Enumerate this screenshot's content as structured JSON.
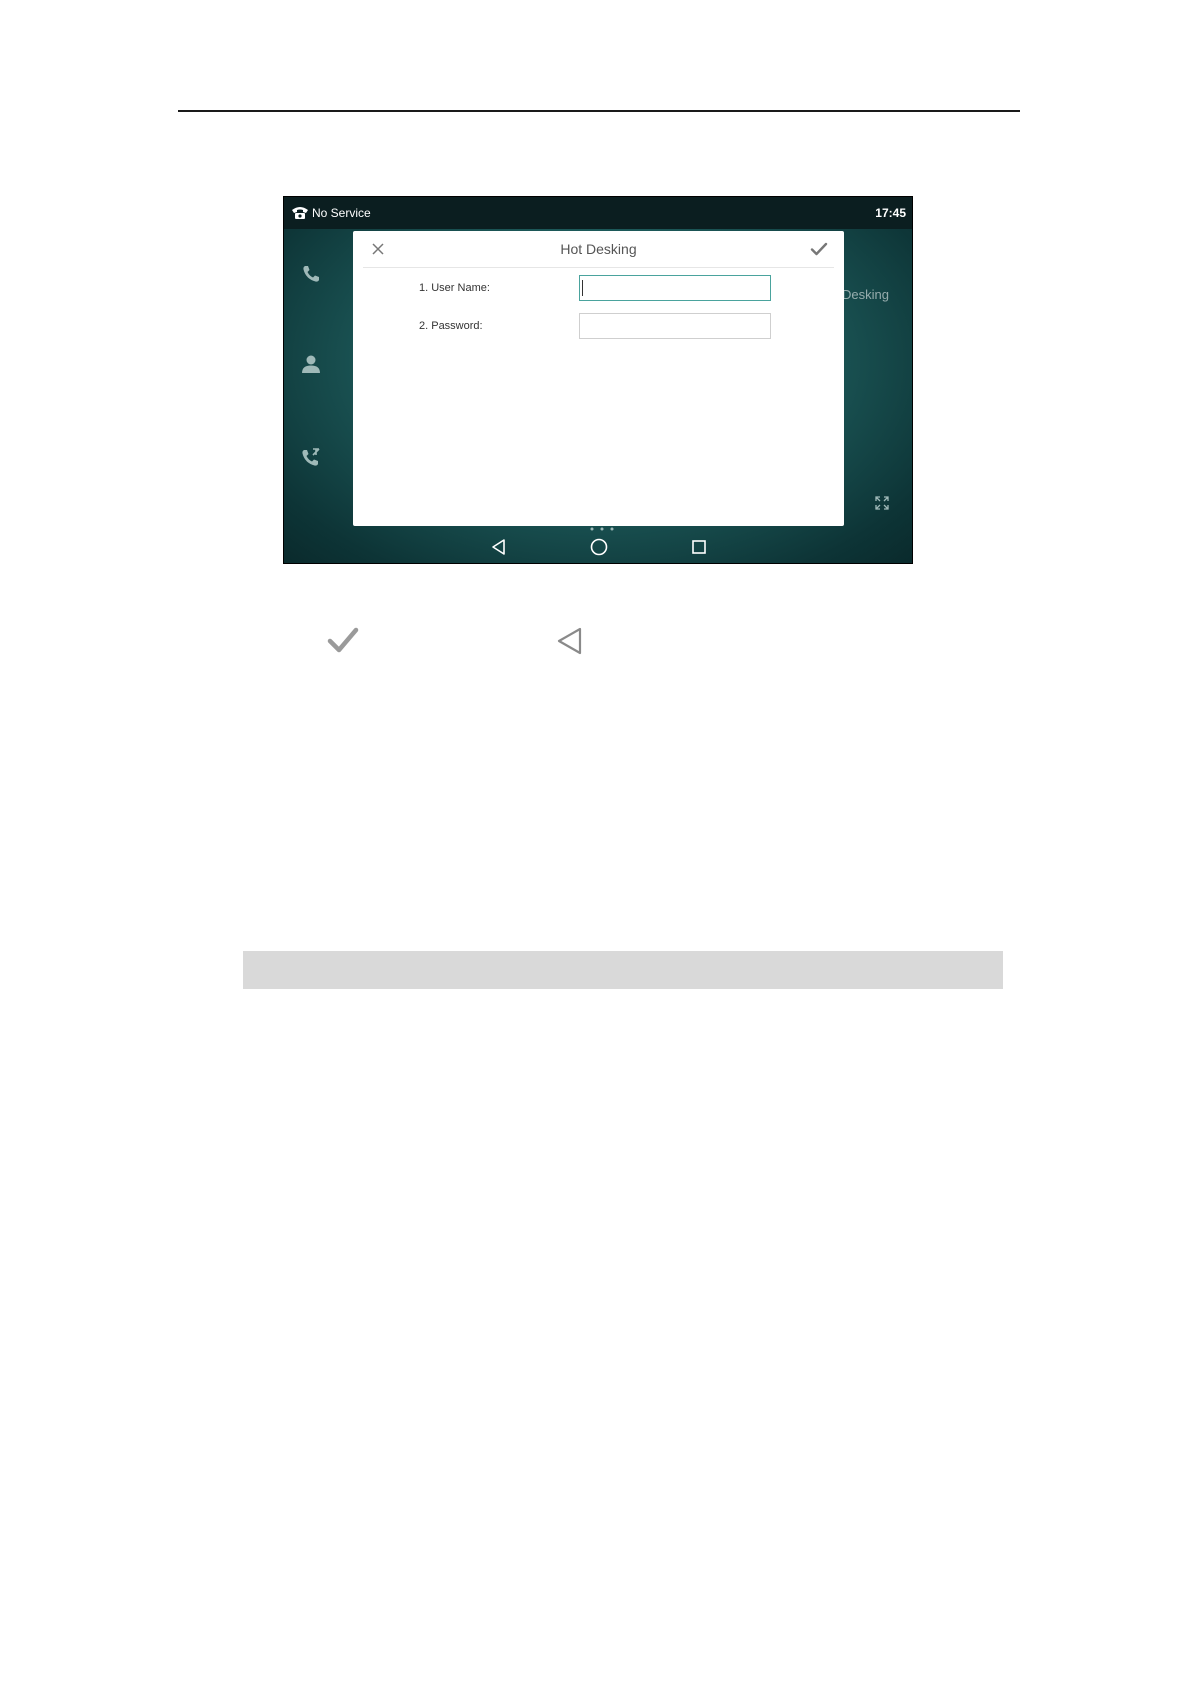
{
  "status_bar": {
    "service_text": "No Service",
    "time": "17:45"
  },
  "dialog": {
    "title": "Hot Desking",
    "fields": [
      {
        "label": "1. User Name:",
        "value": "",
        "placeholder": ""
      },
      {
        "label": "2. Password:",
        "value": "",
        "placeholder": ""
      }
    ]
  },
  "background": {
    "partial_label": "Desking"
  },
  "icons": {
    "status": "phone-handset-icon",
    "side": [
      "phone-icon",
      "contacts-icon",
      "call-history-icon"
    ],
    "nav": [
      "back-icon",
      "home-icon",
      "recents-icon"
    ],
    "expand": "expand-icon",
    "inline": [
      "check-icon",
      "back-icon"
    ]
  },
  "colors": {
    "accent": "#4aa39d",
    "screen_bg": "#1d5a5a",
    "status_bar": "#0b1e20",
    "doc_band": "#d9d9d9"
  }
}
